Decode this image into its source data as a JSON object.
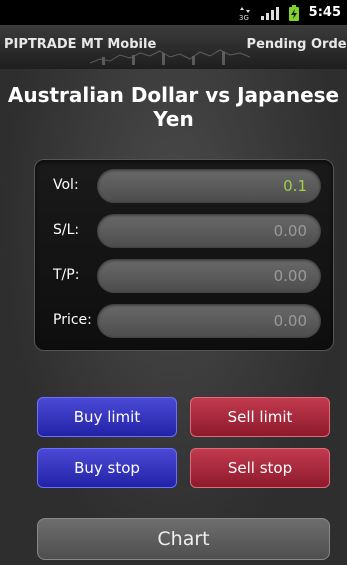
{
  "status_bar": {
    "time": "5:45",
    "icons": [
      "data-3g-icon",
      "signal-icon",
      "battery-charging-icon"
    ]
  },
  "title_bar": {
    "app_title": "PIPTRADE MT Mobile",
    "screen_title": "Pending Order"
  },
  "instrument": {
    "title": "Australian Dollar vs Japanese Yen"
  },
  "form": {
    "fields": [
      {
        "label": "Vol:",
        "value": "0.1"
      },
      {
        "label": "S/L:",
        "value": "0.00"
      },
      {
        "label": "T/P:",
        "value": "0.00"
      },
      {
        "label": "Price:",
        "value": "0.00"
      }
    ]
  },
  "actions": {
    "buy_limit": "Buy limit",
    "sell_limit": "Sell limit",
    "buy_stop": "Buy stop",
    "sell_stop": "Sell stop",
    "chart": "Chart"
  },
  "colors": {
    "accent_value": "#9fd046",
    "buy": "#2f2fc0",
    "sell": "#a52437"
  }
}
